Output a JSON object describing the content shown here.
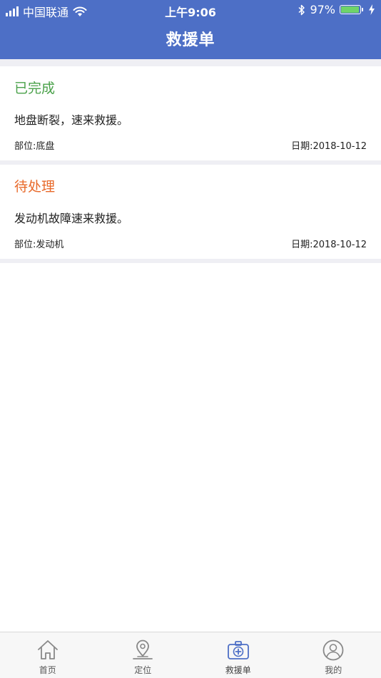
{
  "status_bar": {
    "carrier": "中国联通",
    "time": "上午9:06",
    "battery": "97%",
    "battery_level": 0.97
  },
  "header": {
    "title": "救援单"
  },
  "orders": [
    {
      "status": "已完成",
      "status_color": "#4aa14a",
      "description": "地盘断裂，速来救援。",
      "part": "部位:底盘",
      "date": "日期:2018-10-12"
    },
    {
      "status": "待处理",
      "status_color": "#e8692a",
      "description": "发动机故障速来救援。",
      "part": "部位:发动机",
      "date": "日期:2018-10-12"
    }
  ],
  "tabbar": {
    "items": [
      {
        "label": "首页",
        "icon": "home-icon"
      },
      {
        "label": "定位",
        "icon": "location-pin-icon"
      },
      {
        "label": "救援单",
        "icon": "first-aid-kit-icon",
        "active": true
      },
      {
        "label": "我的",
        "icon": "user-icon"
      }
    ],
    "active_color": "#4d6fc6"
  },
  "colors": {
    "header_bg": "#4d6fc6",
    "battery_fill": "#6fd46a"
  }
}
